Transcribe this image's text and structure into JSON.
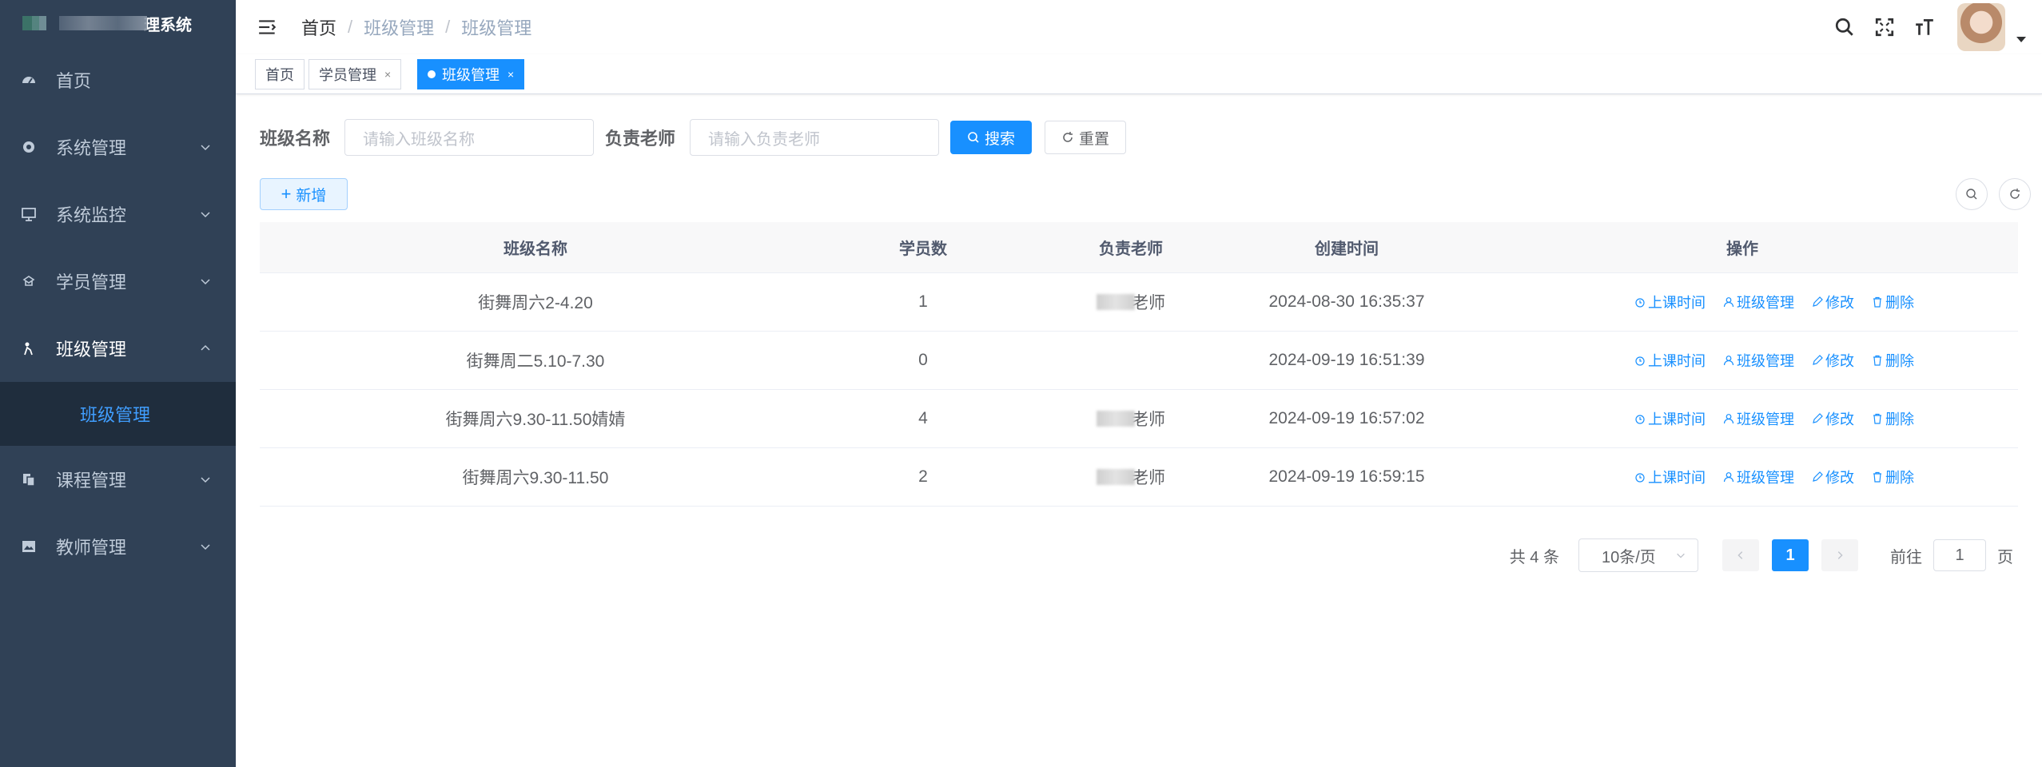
{
  "app": {
    "title_suffix": "理系统"
  },
  "sidebar": {
    "items": [
      {
        "label": "首页",
        "icon": "dashboard-icon"
      },
      {
        "label": "系统管理",
        "icon": "gear-icon"
      },
      {
        "label": "系统监控",
        "icon": "monitor-icon"
      },
      {
        "label": "学员管理",
        "icon": "student-icon"
      },
      {
        "label": "班级管理",
        "icon": "class-icon",
        "expanded": true
      },
      {
        "label": "课程管理",
        "icon": "course-icon"
      },
      {
        "label": "教师管理",
        "icon": "teacher-icon"
      }
    ],
    "submenu_active": "班级管理"
  },
  "breadcrumb": [
    "首页",
    "班级管理",
    "班级管理"
  ],
  "tags": [
    {
      "label": "首页"
    },
    {
      "label": "学员管理",
      "close": "×"
    },
    {
      "label": "班级管理",
      "close": "×",
      "active": true
    }
  ],
  "search": {
    "class_label": "班级名称",
    "class_placeholder": "请输入班级名称",
    "teacher_label": "负责老师",
    "teacher_placeholder": "请输入负责老师",
    "search_btn": "搜索",
    "reset_btn": "重置"
  },
  "toolbar": {
    "add_btn": "新增"
  },
  "table": {
    "headers": [
      "班级名称",
      "学员数",
      "负责老师",
      "创建时间",
      "操作"
    ],
    "rows": [
      {
        "name": "街舞周六2-4.20",
        "count": "1",
        "teacher": "老师",
        "created": "2024-08-30 16:35:37"
      },
      {
        "name": "街舞周二5.10-7.30",
        "count": "0",
        "teacher": "",
        "created": "2024-09-19 16:51:39"
      },
      {
        "name": "街舞周六9.30-11.50婧婧",
        "count": "4",
        "teacher": "老师",
        "created": "2024-09-19 16:57:02"
      },
      {
        "name": "街舞周六9.30-11.50",
        "count": "2",
        "teacher": "老师",
        "created": "2024-09-19 16:59:15"
      }
    ],
    "ops": {
      "schedule": "上课时间",
      "manage": "班级管理",
      "edit": "修改",
      "delete": "删除"
    }
  },
  "pagination": {
    "total": "共 4 条",
    "page_size": "10条/页",
    "current_page": "1",
    "goto_prefix": "前往",
    "goto_value": "1",
    "goto_suffix": "页"
  },
  "colors": {
    "sidebar_bg": "#304156",
    "primary": "#1890ff",
    "submenu_bg": "#1f2d3d"
  }
}
